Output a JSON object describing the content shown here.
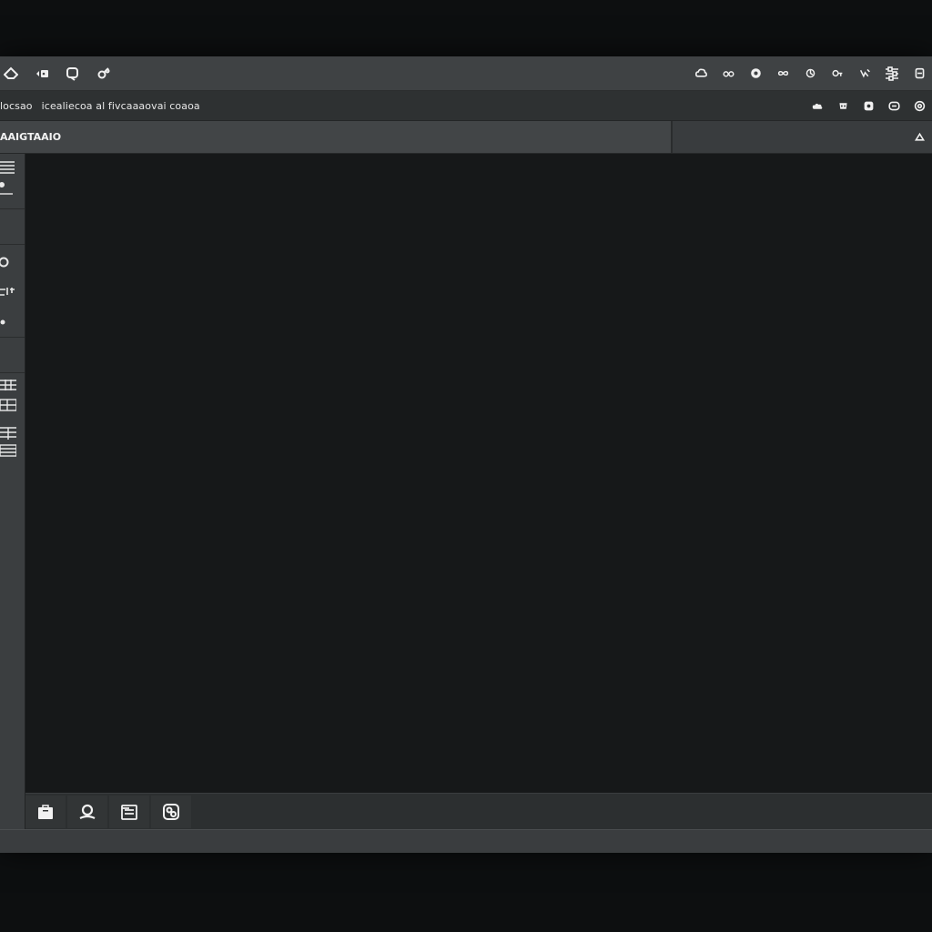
{
  "toolbar": {
    "left_icons": [
      "home-icon",
      "tag-icon",
      "chat-icon",
      "link-icon"
    ],
    "right_icons": [
      "cloud-icon",
      "glasses-icon",
      "eye-icon",
      "infinity-icon",
      "sync-icon",
      "link-icon",
      "key-icon",
      "sliders-icon",
      "document-icon"
    ]
  },
  "pathbar": {
    "text_1": "locsao",
    "text_2": "icealiecoa al fivcaaaovai coaoa",
    "right_icons": [
      "cloud-icon",
      "layers-icon",
      "save-icon",
      "disk-icon",
      "globe-icon"
    ]
  },
  "panel": {
    "label": "AAIGTAAIO",
    "side_icon": "cloud-icon"
  },
  "sidebar": {
    "items": [
      "grid-icon",
      "pin-icon",
      "globe-icon",
      "settings-list-icon",
      "marker-icon",
      "table-icon",
      "table-list-icon"
    ]
  },
  "dock": {
    "items": [
      "bag-icon",
      "user-icon",
      "folder-icon",
      "gallery-icon"
    ]
  },
  "colors": {
    "window_bg": "#3a3d3f",
    "canvas_bg": "#161819",
    "outer_bg": "#0d0f10",
    "text": "#e6e6e6"
  }
}
